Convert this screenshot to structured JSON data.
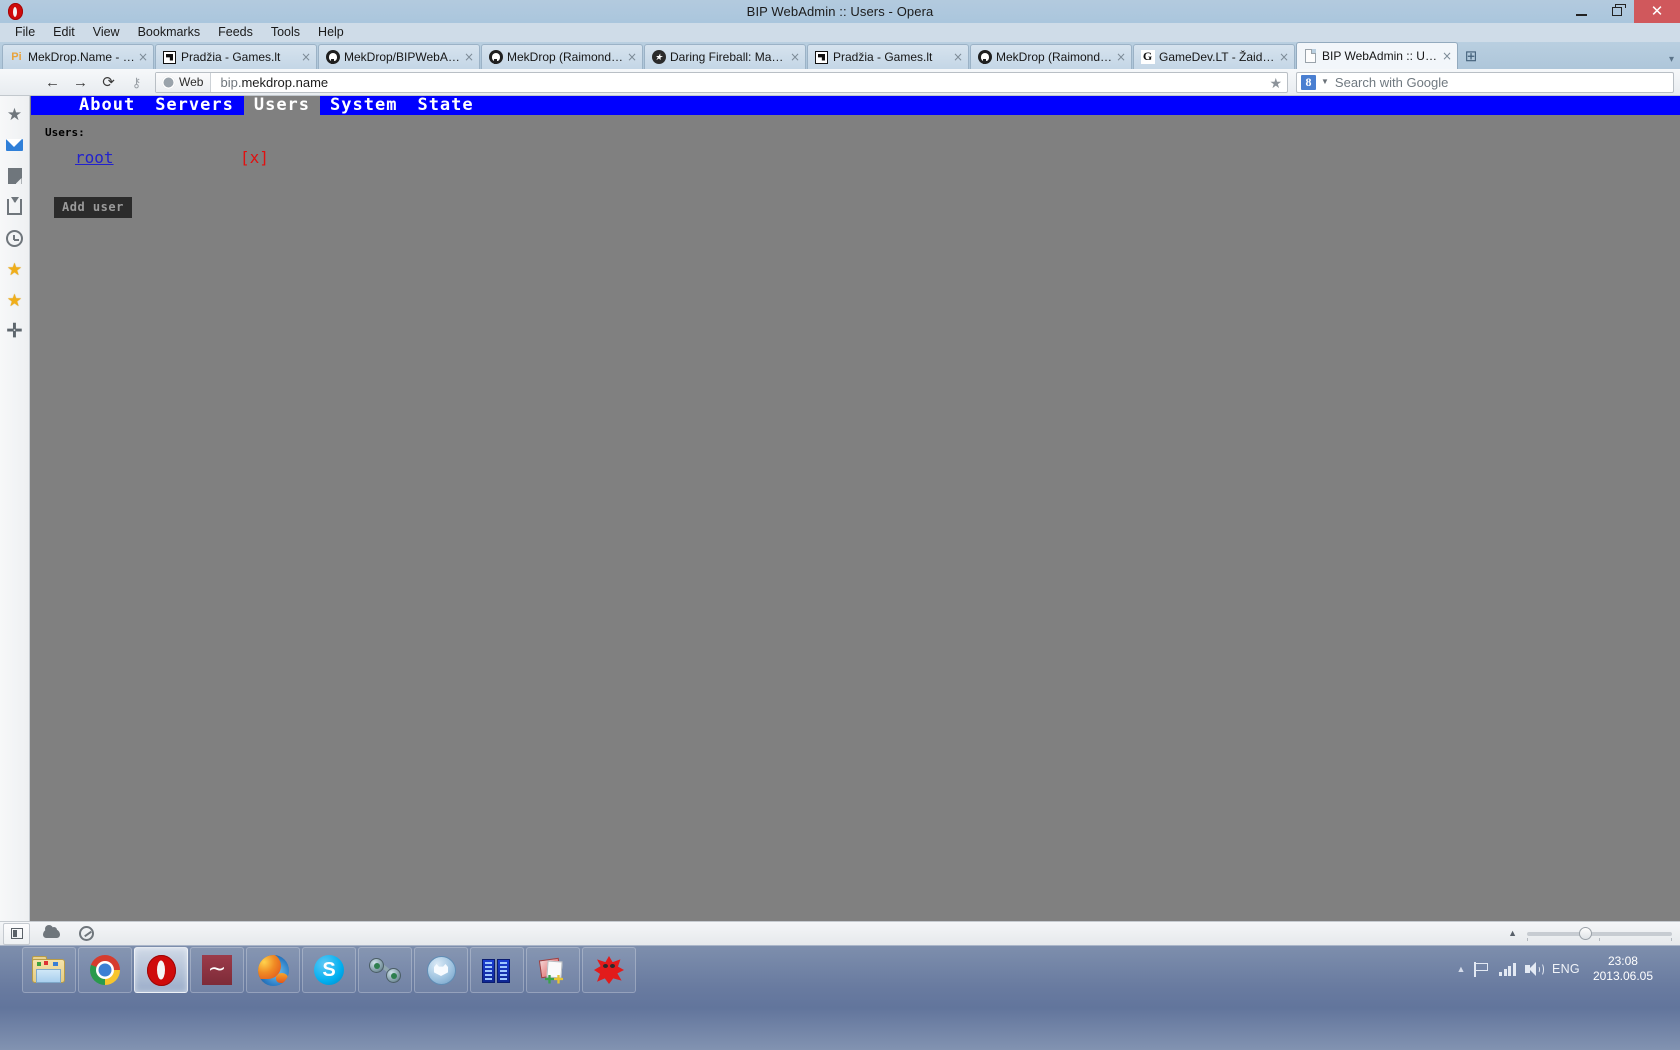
{
  "window": {
    "title": "BIP WebAdmin :: Users - Opera",
    "app_icon": "opera-logo-icon",
    "controls": {
      "minimize": "–",
      "restore": "❐",
      "close": "✕"
    }
  },
  "menubar": {
    "items": [
      {
        "label": "File"
      },
      {
        "label": "Edit"
      },
      {
        "label": "View"
      },
      {
        "label": "Bookmarks"
      },
      {
        "label": "Feeds"
      },
      {
        "label": "Tools"
      },
      {
        "label": "Help"
      }
    ]
  },
  "tabs": {
    "new_tab_label": "+",
    "items": [
      {
        "label": "MekDrop.Name - Piwik...",
        "favicon": "piwik-icon",
        "close": "×",
        "active": false
      },
      {
        "label": "Pradžia - Games.lt",
        "favicon": "gameslt-icon",
        "close": "×",
        "active": false
      },
      {
        "label": "MekDrop/BIPWebAdm...",
        "favicon": "github-icon",
        "close": "×",
        "active": false
      },
      {
        "label": "MekDrop (Raimondas)",
        "favicon": "github-icon",
        "close": "×",
        "active": false
      },
      {
        "label": "Daring Fireball: Markdo...",
        "favicon": "daringfireball-icon",
        "close": "×",
        "active": false
      },
      {
        "label": "Pradžia - Games.lt",
        "favicon": "gameslt-icon",
        "close": "×",
        "active": false
      },
      {
        "label": "MekDrop (Raimondas)",
        "favicon": "github-icon",
        "close": "×",
        "active": false
      },
      {
        "label": "GameDev.LT - Žaidimų...",
        "favicon": "gamedev-icon",
        "close": "×",
        "active": false
      },
      {
        "label": "BIP WebAdmin :: Users",
        "favicon": "document-icon",
        "close": "×",
        "active": true
      }
    ]
  },
  "toolbar": {
    "back_icon": "back-arrow-icon",
    "forward_icon": "forward-arrow-icon",
    "reload_icon": "reload-icon",
    "key_icon": "key-icon",
    "web_badge_label": "Web",
    "url_prefix": "bip.",
    "url_main": "mekdrop.name",
    "url_full": "bip.mekdrop.name",
    "bookmark_star_icon": "star-icon",
    "search_engine_letter": "8",
    "search_placeholder": "Search with Google",
    "search_dropdown_icon": "chevron-down-icon"
  },
  "sidepanel": {
    "items": [
      {
        "name": "speed-dial",
        "icon": "star-gray-icon"
      },
      {
        "name": "mail",
        "icon": "envelope-icon"
      },
      {
        "name": "notes",
        "icon": "note-icon"
      },
      {
        "name": "downloads",
        "icon": "download-icon"
      },
      {
        "name": "history",
        "icon": "clock-icon"
      },
      {
        "name": "bookmarks",
        "icon": "star-gold-icon"
      },
      {
        "name": "favorites",
        "icon": "star-gold-icon"
      },
      {
        "name": "add-panel",
        "icon": "plus-icon"
      }
    ]
  },
  "page": {
    "nav": [
      {
        "label": "About",
        "active": false
      },
      {
        "label": "Servers",
        "active": false
      },
      {
        "label": "Users",
        "active": true
      },
      {
        "label": "System",
        "active": false
      },
      {
        "label": "State",
        "active": false
      }
    ],
    "section_label": "Users:",
    "users": [
      {
        "name": "root",
        "delete_label": "[x]"
      }
    ],
    "add_user_button": "Add user",
    "colors": {
      "nav_background": "#0000ff",
      "nav_active_background": "#808080",
      "page_background": "#808080",
      "username": "#2222cc",
      "delete_link": "#e01010",
      "button_background": "#2b2b2b",
      "button_text": "#9a9a9a"
    }
  },
  "statusbar": {
    "panel_toggle_icon": "panel-toggle-icon",
    "sync_icon": "cloud-icon",
    "turbo_icon": "gauge-icon",
    "zoom_collapse_icon": "caret-up-icon",
    "zoom_value": "100%"
  },
  "taskbar": {
    "items": [
      {
        "name": "windows-explorer",
        "icon": "explorer-folder-icon",
        "active": false
      },
      {
        "name": "google-chrome",
        "icon": "chrome-icon",
        "active": false
      },
      {
        "name": "opera",
        "icon": "opera-icon",
        "active": true
      },
      {
        "name": "tilde-app",
        "icon": "tilde-icon",
        "active": false
      },
      {
        "name": "mozilla-firefox",
        "icon": "firefox-icon",
        "active": false
      },
      {
        "name": "skype",
        "icon": "skype-icon",
        "active": false
      },
      {
        "name": "network-tool",
        "icon": "network-icon",
        "active": false
      },
      {
        "name": "blue-app",
        "icon": "blue-circle-icon",
        "active": false
      },
      {
        "name": "server-rack-app",
        "icon": "server-rack-icon",
        "active": false
      },
      {
        "name": "notepad-plus-plus",
        "icon": "notepad-plus-icon",
        "active": false
      },
      {
        "name": "red-splat-app",
        "icon": "red-splat-icon",
        "active": false
      }
    ],
    "tray": {
      "show_hidden_icon": "caret-up-icon",
      "action_center_icon": "flag-icon",
      "network_icon": "signal-bars-icon",
      "volume_icon": "speaker-icon",
      "language": "ENG",
      "time": "23:08",
      "date": "2013.06.05"
    }
  }
}
